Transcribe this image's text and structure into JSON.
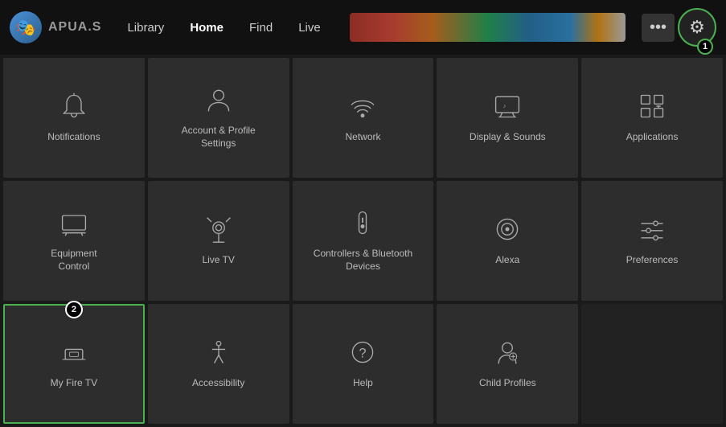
{
  "topbar": {
    "logo_emoji": "🎭",
    "logo_text": "APUA.S",
    "nav": [
      {
        "label": "Library",
        "active": false
      },
      {
        "label": "Home",
        "active": true
      },
      {
        "label": "Find",
        "active": false
      },
      {
        "label": "Live",
        "active": false
      }
    ],
    "dots_label": "•••",
    "gear_icon": "⚙",
    "badge1": "1"
  },
  "grid": {
    "items": [
      {
        "id": "notifications",
        "label": "Notifications",
        "icon": "bell"
      },
      {
        "id": "account",
        "label": "Account & Profile\nSettings",
        "icon": "person"
      },
      {
        "id": "network",
        "label": "Network",
        "icon": "wifi"
      },
      {
        "id": "display-sounds",
        "label": "Display & Sounds",
        "icon": "display"
      },
      {
        "id": "applications",
        "label": "Applications",
        "icon": "apps"
      },
      {
        "id": "equipment-control",
        "label": "Equipment\nControl",
        "icon": "tv"
      },
      {
        "id": "live-tv",
        "label": "Live TV",
        "icon": "antenna"
      },
      {
        "id": "controllers",
        "label": "Controllers & Bluetooth\nDevices",
        "icon": "remote"
      },
      {
        "id": "alexa",
        "label": "Alexa",
        "icon": "alexa"
      },
      {
        "id": "preferences",
        "label": "Preferences",
        "icon": "sliders"
      },
      {
        "id": "my-fire-tv",
        "label": "My Fire TV",
        "icon": "firetv",
        "selected": true,
        "badge": "2"
      },
      {
        "id": "accessibility",
        "label": "Accessibility",
        "icon": "person2"
      },
      {
        "id": "help",
        "label": "Help",
        "icon": "help"
      },
      {
        "id": "child-profiles",
        "label": "Child Profiles",
        "icon": "child"
      },
      {
        "id": "empty",
        "label": "",
        "icon": "none"
      }
    ]
  }
}
